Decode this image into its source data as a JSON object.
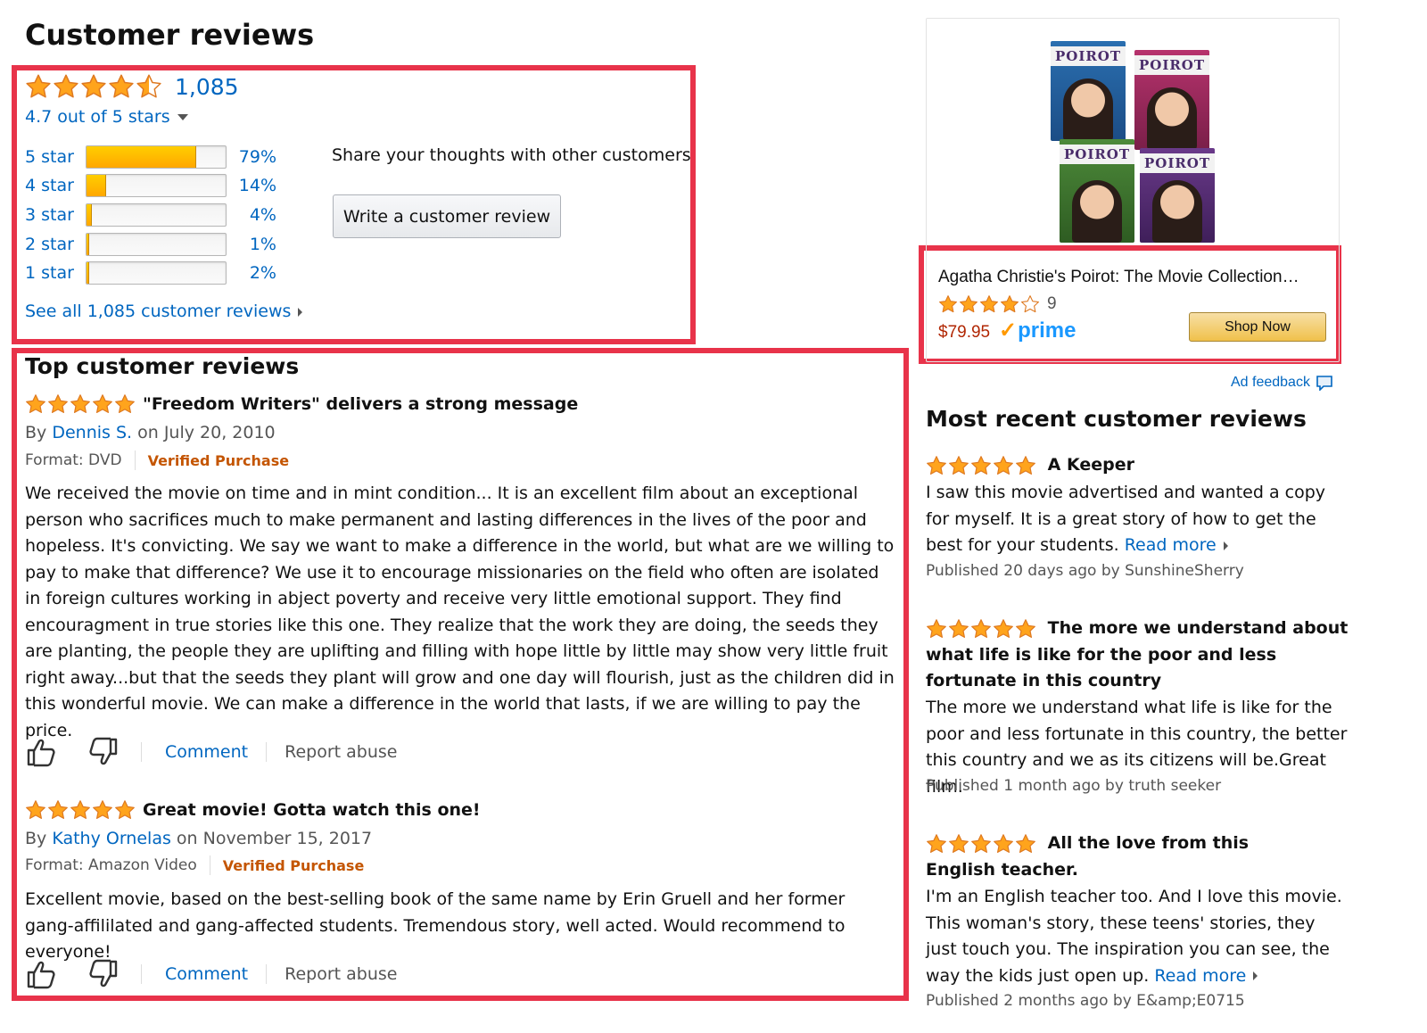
{
  "page_title": "Customer reviews",
  "summary": {
    "rating_count": "1,085",
    "out_of": "4.7 out of 5 stars",
    "histogram": [
      {
        "label": "5 star",
        "pct": "79%",
        "value": 79
      },
      {
        "label": "4 star",
        "pct": "14%",
        "value": 14
      },
      {
        "label": "3 star",
        "pct": "4%",
        "value": 4
      },
      {
        "label": "2 star",
        "pct": "1%",
        "value": 1
      },
      {
        "label": "1 star",
        "pct": "2%",
        "value": 2
      }
    ],
    "share_text": "Share your thoughts with other customers",
    "write_review_label": "Write a customer review",
    "see_all_label": "See all 1,085 customer reviews"
  },
  "top_reviews": {
    "heading": "Top customer reviews",
    "items": [
      {
        "title": "\"Freedom Writers\" delivers a strong message",
        "by_prefix": "By",
        "author": "Dennis S.",
        "date": "on July 20, 2010",
        "format": "Format: DVD",
        "verified": "Verified Purchase",
        "body": "We received the movie on time and in mint condition... It is an excellent film about an exceptional person who sacrifices much to make permanent and lasting differences in the lives of the poor and hopeless. It's convicting. We say we want to make a difference in the world, but what are we willing to pay to make that difference? We use it to encourage missionaries on the field who often are isolated in foreign cultures working in abject poverty and receive very little emotional support. They find encouragment in true stories like this one. They realize that the work they are doing, the seeds they are planting, the people they are uplifting and filling with hope little by little may show very little fruit right away...but that the seeds they plant will grow and one day will flourish, just as the children did in this wonderful movie. We can make a difference in the world that lasts, if we are willing to pay the price.",
        "comment_label": "Comment",
        "report_label": "Report abuse"
      },
      {
        "title": "Great movie! Gotta watch this one!",
        "by_prefix": "By",
        "author": "Kathy Ornelas",
        "date": "on November 15, 2017",
        "format": "Format: Amazon Video",
        "verified": "Verified Purchase",
        "body": "Excellent movie, based on the best-selling book of the same name by Erin Gruell and her former gang-affililated and gang-affected students. Tremendous story, well acted. Would recommend to everyone!",
        "comment_label": "Comment",
        "report_label": "Report abuse"
      }
    ]
  },
  "ad": {
    "covers": [
      "POIROT",
      "POIROT",
      "POIROT",
      "POIROT"
    ],
    "product": "Agatha Christie's Poirot: The Movie Collection…",
    "rating_count": "9",
    "price": "$79.95",
    "prime": "prime",
    "shop_label": "Shop Now",
    "feedback_label": "Ad feedback"
  },
  "recent_reviews": {
    "heading": "Most recent customer reviews",
    "items": [
      {
        "title": "A Keeper",
        "body": "I saw this movie advertised and wanted a copy for myself. It is a great story of how to get the best for your students.",
        "read_more": "Read more",
        "meta": "Published 20 days ago by SunshineSherry"
      },
      {
        "title": "The more we understand about what life is like for the poor and less fortunate in this country",
        "body": "The more we understand what life is like for the poor and less fortunate in this country, the better this country and we as its citizens will be.Great film.",
        "read_more": "",
        "meta": "Published 1 month ago by truth seeker"
      },
      {
        "title": "All the love from this English teacher.",
        "body": "I'm an English teacher too. And I love this movie. This woman's story, these teens' stories, they just touch you. The inspiration you can see, the way the kids just open up.",
        "read_more": "Read more",
        "meta": "Published 2 months ago by E&amp;E0715"
      }
    ]
  },
  "colors": {
    "highlight_border": "#e8334a",
    "link": "#0066c0",
    "star": "#ffa41c",
    "verified": "#c45500",
    "price": "#b12704"
  }
}
